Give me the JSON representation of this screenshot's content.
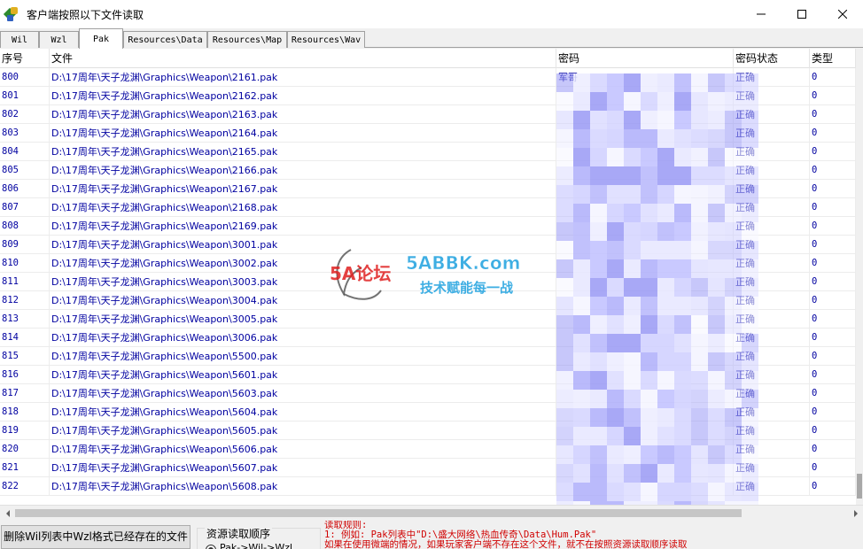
{
  "window": {
    "title": "客户端按照以下文件读取",
    "minimize_label": "",
    "maximize_label": "",
    "close_label": ""
  },
  "tabs": [
    {
      "label": "Wil",
      "active": false
    },
    {
      "label": "Wzl",
      "active": false
    },
    {
      "label": "Pak",
      "active": true
    },
    {
      "label": "Resources\\Data",
      "active": false
    },
    {
      "label": "Resources\\Map",
      "active": false
    },
    {
      "label": "Resources\\Wav",
      "active": false
    }
  ],
  "columns": {
    "index": "序号",
    "file": "文件",
    "password": "密码",
    "password_status": "密码状态",
    "type": "类型"
  },
  "rows": [
    {
      "index": "800",
      "file": "D:\\17周年\\天子龙渊\\Graphics\\Weapon\\2161.pak",
      "password": "军哥",
      "status": "正确",
      "type": "0"
    },
    {
      "index": "801",
      "file": "D:\\17周年\\天子龙渊\\Graphics\\Weapon\\2162.pak",
      "password": "",
      "status": "正确",
      "type": "0"
    },
    {
      "index": "802",
      "file": "D:\\17周年\\天子龙渊\\Graphics\\Weapon\\2163.pak",
      "password": "",
      "status": "正确",
      "type": "0"
    },
    {
      "index": "803",
      "file": "D:\\17周年\\天子龙渊\\Graphics\\Weapon\\2164.pak",
      "password": "",
      "status": "正确",
      "type": "0"
    },
    {
      "index": "804",
      "file": "D:\\17周年\\天子龙渊\\Graphics\\Weapon\\2165.pak",
      "password": "",
      "status": "正确",
      "type": "0"
    },
    {
      "index": "805",
      "file": "D:\\17周年\\天子龙渊\\Graphics\\Weapon\\2166.pak",
      "password": "",
      "status": "正确",
      "type": "0"
    },
    {
      "index": "806",
      "file": "D:\\17周年\\天子龙渊\\Graphics\\Weapon\\2167.pak",
      "password": "",
      "status": "正确",
      "type": "0"
    },
    {
      "index": "807",
      "file": "D:\\17周年\\天子龙渊\\Graphics\\Weapon\\2168.pak",
      "password": "",
      "status": "正确",
      "type": "0"
    },
    {
      "index": "808",
      "file": "D:\\17周年\\天子龙渊\\Graphics\\Weapon\\2169.pak",
      "password": "",
      "status": "正确",
      "type": "0"
    },
    {
      "index": "809",
      "file": "D:\\17周年\\天子龙渊\\Graphics\\Weapon\\3001.pak",
      "password": "",
      "status": "正确",
      "type": "0"
    },
    {
      "index": "810",
      "file": "D:\\17周年\\天子龙渊\\Graphics\\Weapon\\3002.pak",
      "password": "",
      "status": "正确",
      "type": "0"
    },
    {
      "index": "811",
      "file": "D:\\17周年\\天子龙渊\\Graphics\\Weapon\\3003.pak",
      "password": "",
      "status": "正确",
      "type": "0"
    },
    {
      "index": "812",
      "file": "D:\\17周年\\天子龙渊\\Graphics\\Weapon\\3004.pak",
      "password": "",
      "status": "正确",
      "type": "0"
    },
    {
      "index": "813",
      "file": "D:\\17周年\\天子龙渊\\Graphics\\Weapon\\3005.pak",
      "password": "",
      "status": "正确",
      "type": "0"
    },
    {
      "index": "814",
      "file": "D:\\17周年\\天子龙渊\\Graphics\\Weapon\\3006.pak",
      "password": "",
      "status": "正确",
      "type": "0"
    },
    {
      "index": "815",
      "file": "D:\\17周年\\天子龙渊\\Graphics\\Weapon\\5500.pak",
      "password": "",
      "status": "正确",
      "type": "0"
    },
    {
      "index": "816",
      "file": "D:\\17周年\\天子龙渊\\Graphics\\Weapon\\5601.pak",
      "password": "",
      "status": "正确",
      "type": "0"
    },
    {
      "index": "817",
      "file": "D:\\17周年\\天子龙渊\\Graphics\\Weapon\\5603.pak",
      "password": "",
      "status": "正确",
      "type": "0"
    },
    {
      "index": "818",
      "file": "D:\\17周年\\天子龙渊\\Graphics\\Weapon\\5604.pak",
      "password": "",
      "status": "正确",
      "type": "0"
    },
    {
      "index": "819",
      "file": "D:\\17周年\\天子龙渊\\Graphics\\Weapon\\5605.pak",
      "password": "",
      "status": "正确",
      "type": "0"
    },
    {
      "index": "820",
      "file": "D:\\17周年\\天子龙渊\\Graphics\\Weapon\\5606.pak",
      "password": "",
      "status": "正确",
      "type": "0"
    },
    {
      "index": "821",
      "file": "D:\\17周年\\天子龙渊\\Graphics\\Weapon\\5607.pak",
      "password": "",
      "status": "正确",
      "type": "0"
    },
    {
      "index": "822",
      "file": "D:\\17周年\\天子龙渊\\Graphics\\Weapon\\5608.pak",
      "password": "",
      "status": "正确",
      "type": "0"
    }
  ],
  "bottom": {
    "delete_button_label": "删除Wil列表中Wzl格式已经存在的文件",
    "order_group_label": "资源读取顺序",
    "order_option_label": "Pak->Wil->Wzl",
    "rules_title": "读取规则:",
    "rules_line1": "1: 例如: Pak列表中\"D:\\盛大网络\\热血传奇\\Data\\Hum.Pak\"",
    "rules_line2": "   如果在使用微端的情况，如果玩家客户端不存在这个文件，就不在按照资源读取顺序读取"
  },
  "watermark": {
    "logo_text": "5A论坛",
    "site_text": "5ABBK.com",
    "slogan_text": "技术赋能每一战"
  },
  "colors": {
    "row_text": "#0000a0",
    "rules_text": "#d00000",
    "mosaic": "#7b7bff",
    "watermark_site": "#2aa6e0",
    "watermark_red": "#e02020"
  }
}
